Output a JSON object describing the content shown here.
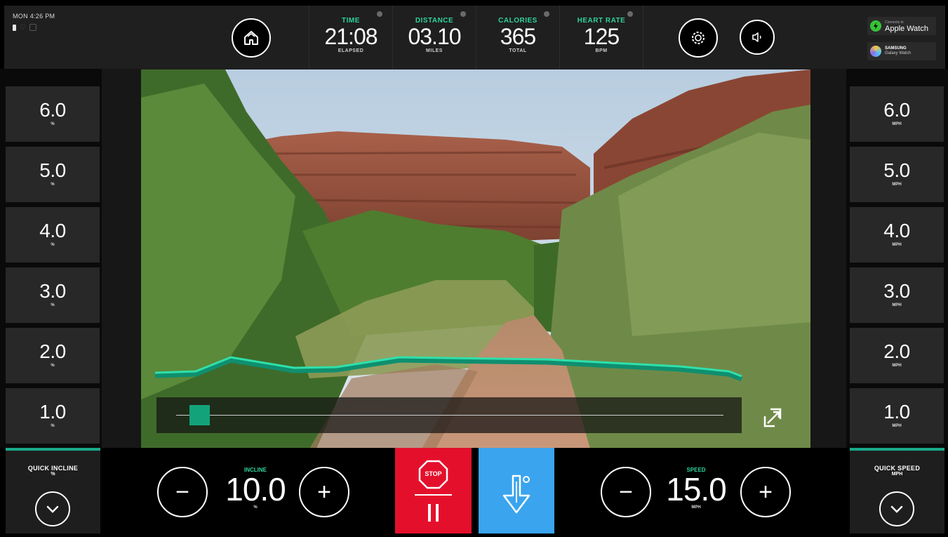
{
  "status": {
    "clock": "MON 4:26 PM"
  },
  "stats": [
    {
      "label": "TIME",
      "value": "21:08",
      "unit": "ELAPSED"
    },
    {
      "label": "DISTANCE",
      "value": "03.10",
      "unit": "MILES"
    },
    {
      "label": "CALORIES",
      "value": "365",
      "unit": "TOTAL"
    },
    {
      "label": "HEART RATE",
      "value": "125",
      "unit": "BPM"
    }
  ],
  "watches": {
    "apple": {
      "small": "Connects to",
      "name": "Apple Watch"
    },
    "samsung": {
      "brand": "SAMSUNG",
      "name": "Galaxy Watch"
    }
  },
  "incline_presets": [
    {
      "value": "6.0",
      "unit": "%"
    },
    {
      "value": "5.0",
      "unit": "%"
    },
    {
      "value": "4.0",
      "unit": "%"
    },
    {
      "value": "3.0",
      "unit": "%"
    },
    {
      "value": "2.0",
      "unit": "%"
    },
    {
      "value": "1.0",
      "unit": "%"
    }
  ],
  "speed_presets": [
    {
      "value": "6.0",
      "unit": "MPH"
    },
    {
      "value": "5.0",
      "unit": "MPH"
    },
    {
      "value": "4.0",
      "unit": "MPH"
    },
    {
      "value": "3.0",
      "unit": "MPH"
    },
    {
      "value": "2.0",
      "unit": "MPH"
    },
    {
      "value": "1.0",
      "unit": "MPH"
    }
  ],
  "video": {
    "progress_fraction": 0.03
  },
  "quick_incline": {
    "label": "QUICK INCLINE",
    "unit": "%"
  },
  "quick_speed": {
    "label": "QUICK SPEED",
    "unit": "MPH"
  },
  "incline": {
    "label": "INCLINE",
    "value": "10.0",
    "unit": "%",
    "minus": "−",
    "plus": "+"
  },
  "speed": {
    "label": "SPEED",
    "value": "15.0",
    "unit": "MPH",
    "minus": "−",
    "plus": "+"
  },
  "stop": {
    "label": "STOP"
  },
  "icons": {
    "home": "home-icon",
    "settings": "gear-icon",
    "volume": "speaker-icon",
    "expand": "expand-icon",
    "cooldown": "cooldown-icon",
    "pause": "pause-icon",
    "chevron": "chevron-down-icon"
  },
  "colors": {
    "accent": "#2fd39a",
    "stop": "#e4102b",
    "cooldown": "#3aa4ee",
    "tile": "#282828"
  }
}
